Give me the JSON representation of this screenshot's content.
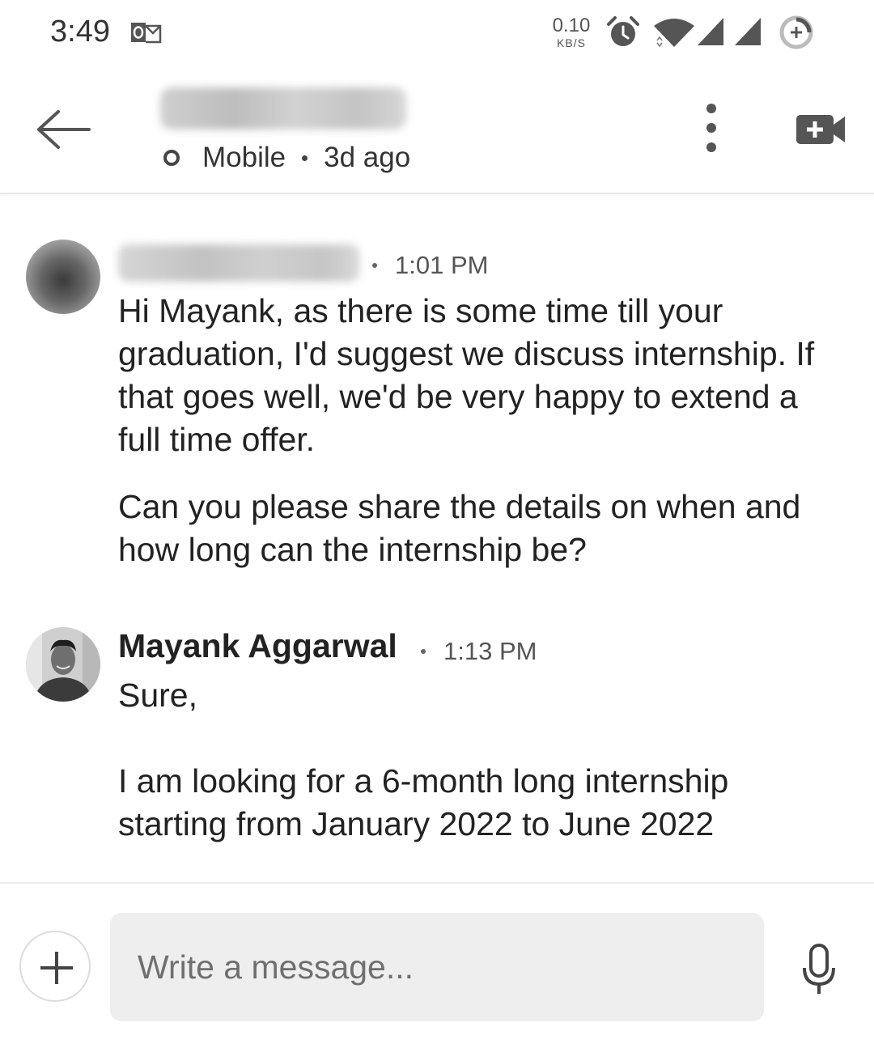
{
  "status_bar": {
    "time": "3:49",
    "net_speed_value": "0.10",
    "net_speed_unit": "KB/S",
    "icons": [
      "outlook-icon",
      "alarm-icon",
      "wifi-icon",
      "cell-signal-icon",
      "cell-signal-icon",
      "battery-saver-icon"
    ]
  },
  "header": {
    "presence": "Mobile",
    "last_seen": "3d ago",
    "icons": [
      "back-arrow-icon",
      "more-vertical-icon",
      "video-call-icon"
    ]
  },
  "messages": [
    {
      "time": "1:01 PM",
      "paragraphs": [
        "Hi Mayank, as there is some time till your graduation, I'd suggest we discuss internship. If that goes well, we'd be very happy to extend a full time offer.",
        "Can you please share the details on when and how long can the internship be?"
      ]
    },
    {
      "sender": "Mayank Aggarwal",
      "time": "1:13 PM",
      "paragraphs": [
        "Sure,",
        "I am looking for a 6-month long internship starting from January 2022 to June 2022"
      ]
    }
  ],
  "composer": {
    "placeholder": "Write a message...",
    "icons": [
      "plus-icon",
      "microphone-icon"
    ]
  },
  "colors": {
    "text": "#222222",
    "muted": "#555555",
    "input_bg": "#eeeeee",
    "icon": "#555555"
  }
}
